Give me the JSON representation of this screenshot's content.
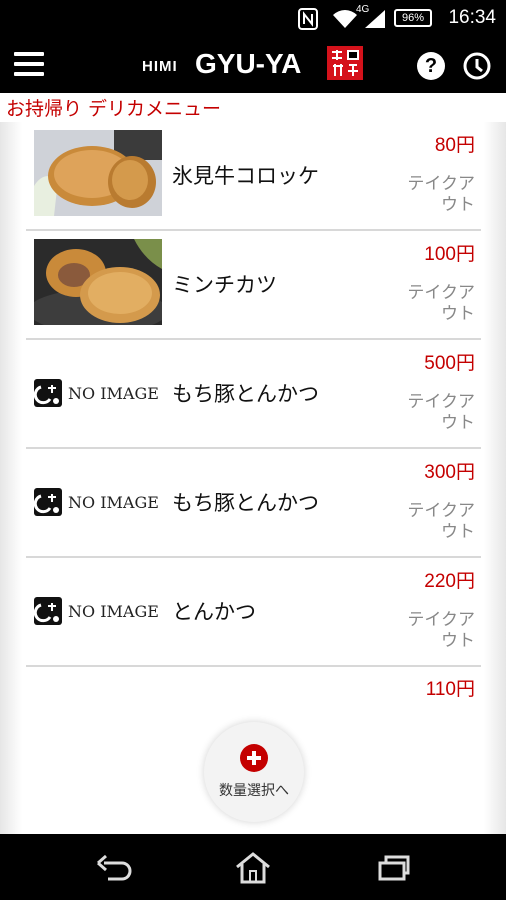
{
  "status_bar": {
    "time": "16:34",
    "battery": "96%",
    "network": "4G",
    "icons": [
      "nfc-icon",
      "wifi-icon",
      "signal-icon",
      "battery-icon"
    ]
  },
  "app_bar": {
    "brand_prefix": "HIMI",
    "brand_name": "GYU-YA",
    "icons": [
      "menu-icon",
      "help-icon",
      "history-icon"
    ]
  },
  "section_title": "お持帰り デリカメニュー",
  "menu_items": [
    {
      "name": "氷見牛コロッケ",
      "price": "80円",
      "tag": "テイクアウト",
      "image": "photo"
    },
    {
      "name": "ミンチカツ",
      "price": "100円",
      "tag": "テイクアウト",
      "image": "photo"
    },
    {
      "name": "もち豚とんかつ",
      "price": "500円",
      "tag": "テイクアウト",
      "image": "NO IMAGE"
    },
    {
      "name": "もち豚とんかつ",
      "price": "300円",
      "tag": "テイクアウト",
      "image": "NO IMAGE"
    },
    {
      "name": "とんかつ",
      "price": "220円",
      "tag": "テイクアウト",
      "image": "NO IMAGE"
    }
  ],
  "partial_item": {
    "price": "110円"
  },
  "fab": {
    "label": "数量選択へ"
  },
  "nav_bar": {
    "icons": [
      "back-icon",
      "home-icon",
      "recent-apps-icon"
    ]
  },
  "colors": {
    "accent_red": "#c40000",
    "bar_black": "#000000"
  }
}
